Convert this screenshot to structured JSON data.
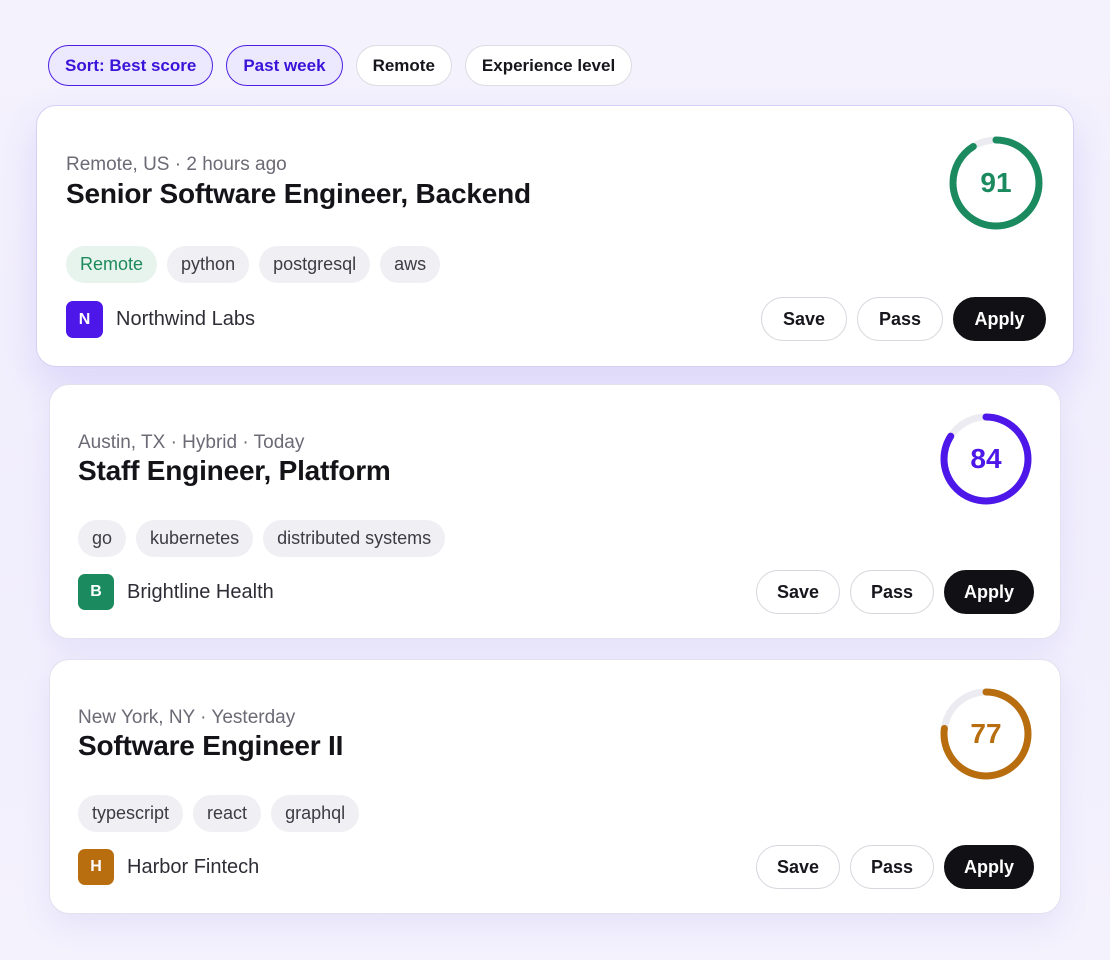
{
  "filters": [
    {
      "label": "Sort: Best score",
      "active": true
    },
    {
      "label": "Past week",
      "active": true
    },
    {
      "label": "Remote",
      "active": false
    },
    {
      "label": "Experience level",
      "active": false
    }
  ],
  "jobs": [
    {
      "meta": "Remote, US · 2 hours ago",
      "title": "Senior Software Engineer, Backend",
      "tags": [
        "Remote",
        "python",
        "postgresql",
        "aws"
      ],
      "company": "Northwind Labs",
      "logo_letter": "N",
      "logo_color": "#4c17e8",
      "score": 91,
      "score_color": "#1b8a5f",
      "actions": {
        "save": "Save",
        "pass": "Pass",
        "apply": "Apply"
      }
    },
    {
      "meta": "Austin, TX · Hybrid · Today",
      "title": "Staff Engineer, Platform",
      "tags": [
        "go",
        "kubernetes",
        "distributed systems"
      ],
      "company": "Brightline Health",
      "logo_letter": "B",
      "logo_color": "#1b8a5f",
      "score": 84,
      "score_color": "#4c17e8",
      "actions": {
        "save": "Save",
        "pass": "Pass",
        "apply": "Apply"
      }
    },
    {
      "meta": "New York, NY · Yesterday",
      "title": "Software Engineer II",
      "tags": [
        "typescript",
        "react",
        "graphql"
      ],
      "company": "Harbor Fintech",
      "logo_letter": "H",
      "logo_color": "#b86e0f",
      "score": 77,
      "score_color": "#b86e0f",
      "actions": {
        "save": "Save",
        "pass": "Pass",
        "apply": "Apply"
      }
    }
  ],
  "colors": {
    "accent": "#4c17e8",
    "ring_track": "#ecebf1"
  }
}
